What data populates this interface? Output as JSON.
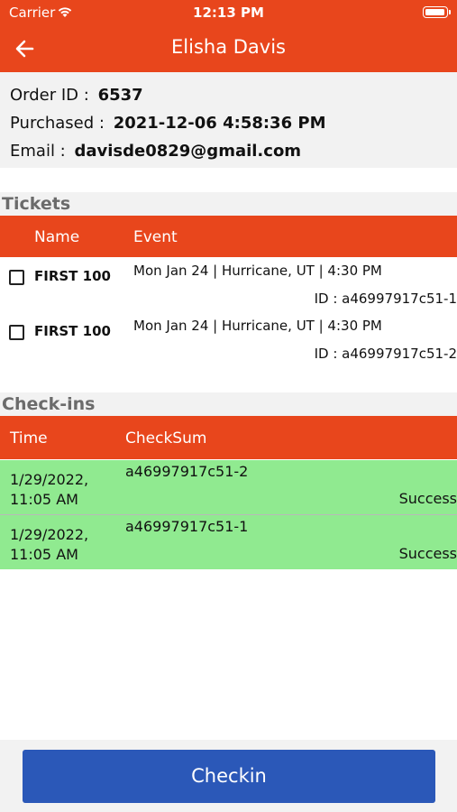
{
  "status_bar": {
    "carrier": "Carrier",
    "time": "12:13 PM"
  },
  "nav": {
    "title": "Elisha Davis"
  },
  "order": {
    "id_label": "Order ID :",
    "id_value": "6537",
    "purchased_label": "Purchased :",
    "purchased_value": "2021-12-06 4:58:36 PM",
    "email_label": "Email :",
    "email_value": "davisde0829@gmail.com"
  },
  "tickets": {
    "section_title": "Tickets",
    "columns": {
      "name": "Name",
      "event": "Event"
    },
    "rows": [
      {
        "name": "FIRST 100",
        "event": "Mon Jan 24 | Hurricane, UT | 4:30 PM",
        "id": "ID : a46997917c51-1"
      },
      {
        "name": "FIRST 100",
        "event": "Mon Jan 24 | Hurricane, UT | 4:30 PM",
        "id": "ID : a46997917c51-2"
      }
    ]
  },
  "checkins": {
    "section_title": "Check-ins",
    "columns": {
      "time": "Time",
      "checksum": "CheckSum"
    },
    "rows": [
      {
        "time": "1/29/2022, 11:05 AM",
        "checksum": "a46997917c51-2",
        "result": "Success"
      },
      {
        "time": "1/29/2022, 11:05 AM",
        "checksum": "a46997917c51-1",
        "result": "Success"
      }
    ]
  },
  "footer": {
    "checkin_label": "Checkin"
  },
  "colors": {
    "accent": "#E8461C",
    "success_row": "#90EA90",
    "button": "#2B58B8"
  }
}
